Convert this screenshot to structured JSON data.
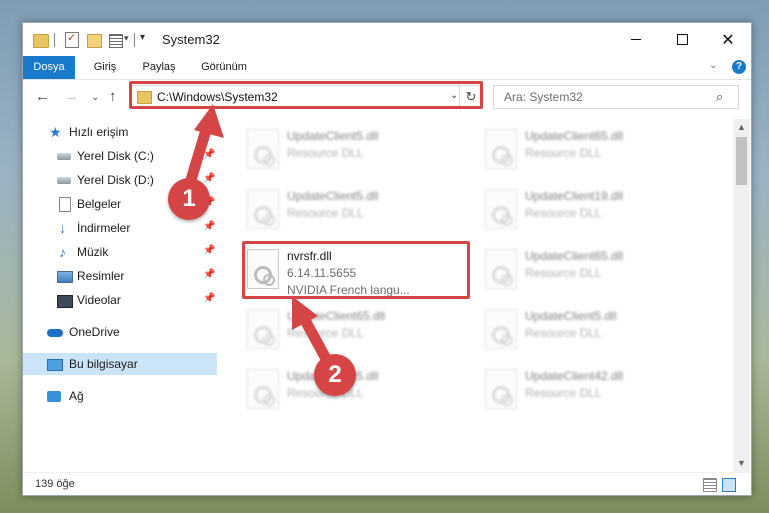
{
  "window": {
    "title": "System32",
    "controls": {
      "minimize": "—",
      "maximize": "□",
      "close": "✕"
    }
  },
  "ribbon": {
    "tabs": [
      "Dosya",
      "Giriş",
      "Paylaş",
      "Görünüm"
    ],
    "help": "?"
  },
  "navbar": {
    "address": "C:\\Windows\\System32",
    "search_placeholder": "Ara: System32",
    "refresh": "↻"
  },
  "sidebar": {
    "items": [
      {
        "label": "Hızlı erişim",
        "icon": "quick-access-star-icon"
      },
      {
        "label": "Yerel Disk (C:)",
        "icon": "disk-icon",
        "pinned": true
      },
      {
        "label": "Yerel Disk (D:)",
        "icon": "disk-icon",
        "pinned": true
      },
      {
        "label": "Belgeler",
        "icon": "documents-icon",
        "pinned": true
      },
      {
        "label": "İndirmeler",
        "icon": "downloads-icon",
        "pinned": true
      },
      {
        "label": "Müzik",
        "icon": "music-icon",
        "pinned": true
      },
      {
        "label": "Resimler",
        "icon": "pictures-icon",
        "pinned": true
      },
      {
        "label": "Videolar",
        "icon": "videos-icon",
        "pinned": true
      },
      {
        "label": "OneDrive",
        "icon": "onedrive-cloud-icon"
      },
      {
        "label": "Bu bilgisayar",
        "icon": "this-pc-icon",
        "selected": true
      },
      {
        "label": "Ağ",
        "icon": "network-icon"
      }
    ]
  },
  "files": [
    {
      "name": "UpdateClient5.dll",
      "desc": "Resource DLL",
      "blurred": true
    },
    {
      "name": "UpdateClient65.dll",
      "desc": "Resource DLL",
      "blurred": true
    },
    {
      "name": "UpdateClient5.dll",
      "desc": "Resource DLL",
      "blurred": true
    },
    {
      "name": "UpdateClient19.dll",
      "desc": "Resource DLL",
      "blurred": true
    },
    {
      "name": "nvrsfr.dll",
      "desc": "6.14.11.5655",
      "desc2": "NVIDIA French langu...",
      "blurred": false
    },
    {
      "name": "UpdateClient65.dll",
      "desc": "Resource DLL",
      "blurred": true
    },
    {
      "name": "UpdateClient65.dll",
      "desc": "Resource DLL",
      "blurred": true
    },
    {
      "name": "UpdateClient5.dll",
      "desc": "Resource DLL",
      "blurred": true
    },
    {
      "name": "UpdateClient5.dll",
      "desc": "Resource DLL",
      "blurred": true
    },
    {
      "name": "UpdateClient42.dll",
      "desc": "Resource DLL",
      "blurred": true
    }
  ],
  "status": {
    "item_count": "139 öğe"
  },
  "annotations": {
    "step1": "1",
    "step2": "2",
    "color": "#d64545"
  }
}
